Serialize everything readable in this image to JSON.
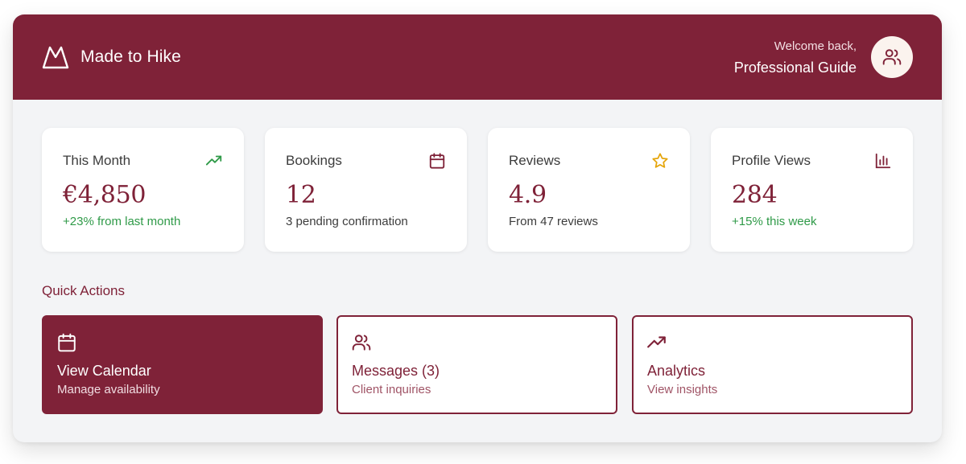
{
  "colors": {
    "brand": "#7f2238",
    "positive": "#2f9a48",
    "star": "#e5a50a",
    "background": "#f3f4f6"
  },
  "header": {
    "brand": "Made to Hike",
    "logo_icon": "mountain-icon",
    "welcome": "Welcome back,",
    "user_name": "Professional Guide",
    "avatar_icon": "users-icon"
  },
  "stats": [
    {
      "label": "This Month",
      "value": "€4,850",
      "sub": "+23% from last month",
      "icon": "trending-up-icon"
    },
    {
      "label": "Bookings",
      "value": "12",
      "sub": "3 pending confirmation",
      "icon": "calendar-icon"
    },
    {
      "label": "Reviews",
      "value": "4.9",
      "sub": "From 47 reviews",
      "icon": "star-icon"
    },
    {
      "label": "Profile Views",
      "value": "284",
      "sub": "+15% this week",
      "icon": "bar-chart-icon"
    }
  ],
  "quick_actions": {
    "title": "Quick Actions",
    "items": [
      {
        "title": "View Calendar",
        "sub": "Manage availability",
        "icon": "calendar-icon"
      },
      {
        "title": "Messages (3)",
        "sub": "Client inquiries",
        "icon": "users-icon"
      },
      {
        "title": "Analytics",
        "sub": "View insights",
        "icon": "trending-up-icon"
      }
    ]
  }
}
